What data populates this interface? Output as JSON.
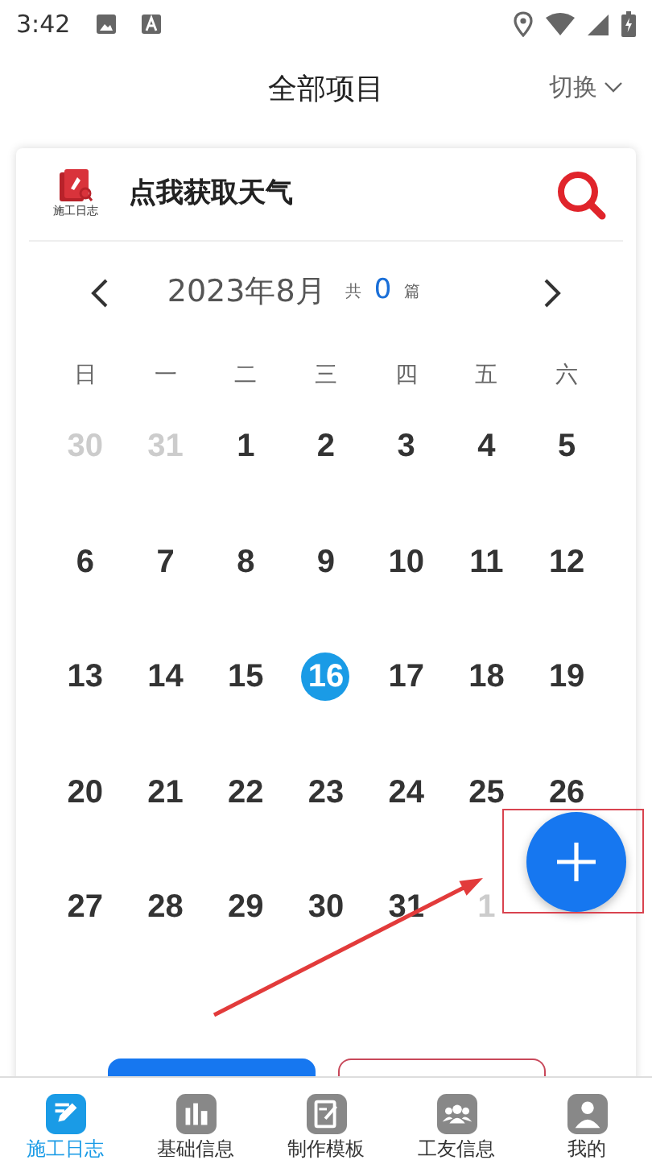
{
  "status_bar": {
    "time": "3:42"
  },
  "header": {
    "title": "全部项目",
    "switch": "切换"
  },
  "card": {
    "logo_caption": "施工日志",
    "weather": "点我获取天气"
  },
  "calendar": {
    "month": "2023年8月",
    "total_prefix": "共",
    "total": "0",
    "total_suffix": "篇",
    "weekdays": [
      "日",
      "一",
      "二",
      "三",
      "四",
      "五",
      "六"
    ],
    "weeks": [
      [
        {
          "day": "30",
          "kind": "other",
          "selected": false
        },
        {
          "day": "31",
          "kind": "other",
          "selected": false
        },
        {
          "day": "1",
          "kind": "current",
          "selected": false
        },
        {
          "day": "2",
          "kind": "current",
          "selected": false
        },
        {
          "day": "3",
          "kind": "current",
          "selected": false
        },
        {
          "day": "4",
          "kind": "current",
          "selected": false
        },
        {
          "day": "5",
          "kind": "current",
          "selected": false
        }
      ],
      [
        {
          "day": "6",
          "kind": "current",
          "selected": false
        },
        {
          "day": "7",
          "kind": "current",
          "selected": false
        },
        {
          "day": "8",
          "kind": "current",
          "selected": false
        },
        {
          "day": "9",
          "kind": "current",
          "selected": false
        },
        {
          "day": "10",
          "kind": "current",
          "selected": false
        },
        {
          "day": "11",
          "kind": "current",
          "selected": false
        },
        {
          "day": "12",
          "kind": "current",
          "selected": false
        }
      ],
      [
        {
          "day": "13",
          "kind": "current",
          "selected": false
        },
        {
          "day": "14",
          "kind": "current",
          "selected": false
        },
        {
          "day": "15",
          "kind": "current",
          "selected": false
        },
        {
          "day": "16",
          "kind": "current",
          "selected": true
        },
        {
          "day": "17",
          "kind": "current",
          "selected": false
        },
        {
          "day": "18",
          "kind": "current",
          "selected": false
        },
        {
          "day": "19",
          "kind": "current",
          "selected": false
        }
      ],
      [
        {
          "day": "20",
          "kind": "current",
          "selected": false
        },
        {
          "day": "21",
          "kind": "current",
          "selected": false
        },
        {
          "day": "22",
          "kind": "current",
          "selected": false
        },
        {
          "day": "23",
          "kind": "current",
          "selected": false
        },
        {
          "day": "24",
          "kind": "current",
          "selected": false
        },
        {
          "day": "25",
          "kind": "current",
          "selected": false
        },
        {
          "day": "26",
          "kind": "current",
          "selected": false
        }
      ],
      [
        {
          "day": "27",
          "kind": "current",
          "selected": false
        },
        {
          "day": "28",
          "kind": "current",
          "selected": false
        },
        {
          "day": "29",
          "kind": "current",
          "selected": false
        },
        {
          "day": "30",
          "kind": "current",
          "selected": false
        },
        {
          "day": "31",
          "kind": "current",
          "selected": false
        },
        {
          "day": "1",
          "kind": "other",
          "selected": false
        }
      ]
    ]
  },
  "tabs": [
    {
      "label": "施工日志",
      "kind": "log",
      "selected": true
    },
    {
      "label": "基础信息",
      "kind": "info",
      "selected": false
    },
    {
      "label": "制作模板",
      "kind": "template",
      "selected": false
    },
    {
      "label": "工友信息",
      "kind": "workers",
      "selected": false
    },
    {
      "label": "我的",
      "kind": "me",
      "selected": false
    }
  ]
}
